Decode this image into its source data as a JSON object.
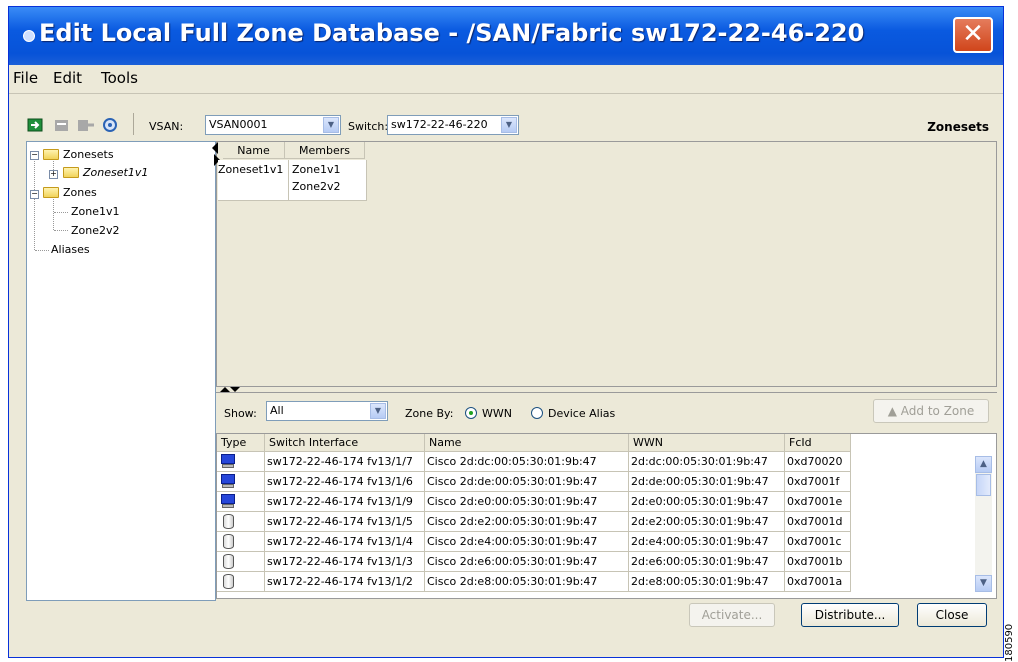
{
  "window": {
    "title": "Edit Local Full Zone Database - /SAN/Fabric sw172-22-46-220",
    "close_glyph": "✕"
  },
  "menu": {
    "items": [
      "File",
      "Edit",
      "Tools"
    ]
  },
  "toolbar": {
    "icons": [
      "activate-zone-icon",
      "delete-icon",
      "insert-icon",
      "refresh-icon"
    ],
    "vsan_label": "VSAN:",
    "vsan_value": "VSAN0001",
    "switch_label": "Switch:",
    "switch_value": "sw172-22-46-220",
    "section_title": "Zonesets"
  },
  "tree": {
    "zonesets": "Zonesets",
    "zoneset1": "Zoneset1v1",
    "zones": "Zones",
    "zone1": "Zone1v1",
    "zone2": "Zone2v2",
    "aliases": "Aliases",
    "collapse_glyph": "−",
    "expand_glyph": "+"
  },
  "zonesets_table": {
    "headers": [
      "Name",
      "Members"
    ],
    "rows": [
      {
        "name": "Zoneset1v1",
        "members": [
          "Zone1v1",
          "Zone2v2"
        ]
      }
    ]
  },
  "filter": {
    "show_label": "Show:",
    "show_value": "All",
    "zone_by_label": "Zone By:",
    "option_wwn": "WWN",
    "option_alias": "Device Alias",
    "selected": "WWN",
    "add_to_zone": "Add to Zone"
  },
  "members_table": {
    "headers": [
      "Type",
      "Switch Interface",
      "Name",
      "WWN",
      "FcId"
    ],
    "rows": [
      {
        "type": "host",
        "iface": "sw172-22-46-174 fv13/1/7",
        "name": "Cisco 2d:dc:00:05:30:01:9b:47",
        "wwn": "2d:dc:00:05:30:01:9b:47",
        "fcid": "0xd70020"
      },
      {
        "type": "host",
        "iface": "sw172-22-46-174 fv13/1/6",
        "name": "Cisco 2d:de:00:05:30:01:9b:47",
        "wwn": "2d:de:00:05:30:01:9b:47",
        "fcid": "0xd7001f"
      },
      {
        "type": "host",
        "iface": "sw172-22-46-174 fv13/1/9",
        "name": "Cisco 2d:e0:00:05:30:01:9b:47",
        "wwn": "2d:e0:00:05:30:01:9b:47",
        "fcid": "0xd7001e"
      },
      {
        "type": "storage",
        "iface": "sw172-22-46-174 fv13/1/5",
        "name": "Cisco 2d:e2:00:05:30:01:9b:47",
        "wwn": "2d:e2:00:05:30:01:9b:47",
        "fcid": "0xd7001d"
      },
      {
        "type": "storage",
        "iface": "sw172-22-46-174 fv13/1/4",
        "name": "Cisco 2d:e4:00:05:30:01:9b:47",
        "wwn": "2d:e4:00:05:30:01:9b:47",
        "fcid": "0xd7001c"
      },
      {
        "type": "storage",
        "iface": "sw172-22-46-174 fv13/1/3",
        "name": "Cisco 2d:e6:00:05:30:01:9b:47",
        "wwn": "2d:e6:00:05:30:01:9b:47",
        "fcid": "0xd7001b"
      },
      {
        "type": "storage",
        "iface": "sw172-22-46-174 fv13/1/2",
        "name": "Cisco 2d:e8:00:05:30:01:9b:47",
        "wwn": "2d:e8:00:05:30:01:9b:47",
        "fcid": "0xd7001a"
      }
    ]
  },
  "footer": {
    "activate": "Activate...",
    "distribute": "Distribute...",
    "close": "Close"
  },
  "figure_code": "180590"
}
